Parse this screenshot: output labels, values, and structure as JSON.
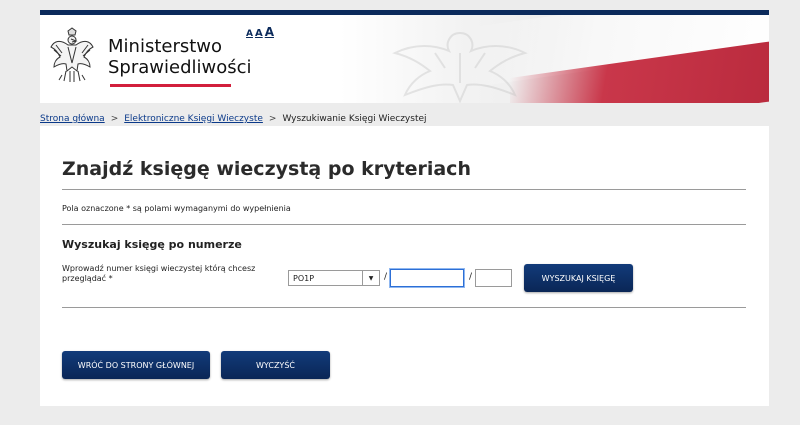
{
  "header": {
    "ministry_line1": "Ministerstwo",
    "ministry_line2": "Sprawiedliwości",
    "font_sizes": [
      "A",
      "A",
      "A"
    ]
  },
  "breadcrumb": {
    "home": "Strona główna",
    "ekw": "Elektroniczne Księgi Wieczyste",
    "current": "Wyszukiwanie Księgi Wieczystej",
    "separator": ">"
  },
  "main": {
    "title": "Znajdź księgę wieczystą po kryteriach",
    "required_note": "Pola oznaczone * są polami wymaganymi do wypełnienia",
    "section_title": "Wyszukaj księgę po numerze",
    "prompt": "Wprowadź numer księgi wieczystej którą chcesz przeglądać *",
    "court_code_value": "PO1P",
    "number_value": "",
    "check_digit_value": "",
    "slash": "/",
    "search_button": "WYSZUKAJ KSIĘGĘ",
    "back_button": "WRÓĆ DO STRONY GŁÓWNEJ",
    "clear_button": "WYCZYŚĆ"
  },
  "colors": {
    "navy": "#0c2d63",
    "red_accent": "#d21f3c",
    "link": "#0b3a8a"
  }
}
